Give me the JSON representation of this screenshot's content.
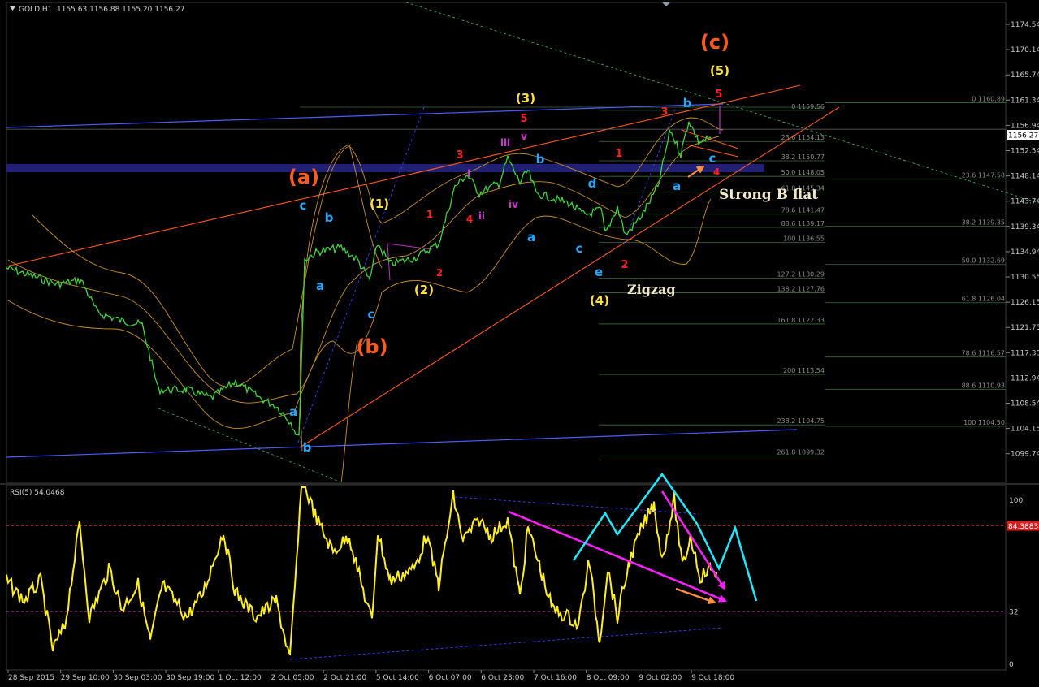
{
  "header": {
    "symbol_tf": "GOLD,H1",
    "ohlc": "1155.63 1156.88 1155.20 1156.27"
  },
  "price_axis": {
    "labels": [
      "1174.54",
      "1170.14",
      "1165.74",
      "1161.34",
      "1156.94",
      "1152.54",
      "1148.14",
      "1143.74",
      "1139.34",
      "1134.94",
      "1130.55",
      "1126.15",
      "1121.75",
      "1117.35",
      "1112.94",
      "1108.54",
      "1104.15",
      "1099.74"
    ],
    "current_price": "1156.27"
  },
  "rsi": {
    "title": "RSI(5) 54.0468",
    "levels": [
      "100",
      "32",
      "0"
    ],
    "upper_level_tag": "84.3883"
  },
  "time_axis": {
    "labels": [
      "28 Sep 2015",
      "29 Sep 10:00",
      "30 Sep 03:00",
      "30 Sep 19:00",
      "1 Oct 12:00",
      "2 Oct 05:00",
      "2 Oct 21:00",
      "5 Oct 14:00",
      "6 Oct 07:00",
      "6 Oct 23:00",
      "7 Oct 16:00",
      "8 Oct 09:00",
      "9 Oct 02:00",
      "9 Oct 18:00"
    ]
  },
  "fib_a": [
    {
      "label": "0 1159.56",
      "price": 1159.56
    },
    {
      "label": "23.6 1154.13",
      "price": 1154.13
    },
    {
      "label": "38.2 1150.77",
      "price": 1150.77
    },
    {
      "label": "50.0 1148.05",
      "price": 1148.05
    },
    {
      "label": "61.8 1145.34",
      "price": 1145.34
    },
    {
      "label": "78.6 1141.47",
      "price": 1141.47
    },
    {
      "label": "88.6 1139.17",
      "price": 1139.17
    },
    {
      "label": "100 1136.55",
      "price": 1136.55
    },
    {
      "label": "127.2 1130.29",
      "price": 1130.29
    },
    {
      "label": "138.2 1127.76",
      "price": 1127.76
    },
    {
      "label": "161.8 1122.33",
      "price": 1122.33
    },
    {
      "label": "200 1113.54",
      "price": 1113.54
    },
    {
      "label": "238.2 1104.75",
      "price": 1104.75
    },
    {
      "label": "261.8 1099.32",
      "price": 1099.32
    }
  ],
  "fib_b": [
    {
      "label": "0 1160.89",
      "price": 1160.89
    },
    {
      "label": "23.6 1147.58",
      "price": 1147.58
    },
    {
      "label": "38.2 1139.35",
      "price": 1139.35
    },
    {
      "label": "50.0 1132.69",
      "price": 1132.69
    },
    {
      "label": "61.8 1126.04",
      "price": 1126.04
    },
    {
      "label": "78.6 1116.57",
      "price": 1116.57
    },
    {
      "label": "88.6 1110.93",
      "price": 1110.93
    },
    {
      "label": "100 1104.50",
      "price": 1104.5
    }
  ],
  "wave_labels": [
    {
      "t": "(c)",
      "c": "#ff5a1e",
      "s": 24
    },
    {
      "t": "(5)",
      "c": "#ffe040",
      "s": 15
    },
    {
      "t": "5",
      "c": "#ff2020",
      "s": 13
    },
    {
      "t": "b",
      "c": "#2aa8ff",
      "s": 15
    },
    {
      "t": "3",
      "c": "#ff2020",
      "s": 13
    },
    {
      "t": "c",
      "c": "#2aa8ff",
      "s": 15
    },
    {
      "t": "4",
      "c": "#ff2020",
      "s": 12
    },
    {
      "t": "a",
      "c": "#2aa8ff",
      "s": 15
    },
    {
      "t": "(3)",
      "c": "#ffe040",
      "s": 15
    },
    {
      "t": "5",
      "c": "#ff2020",
      "s": 13
    },
    {
      "t": "v",
      "c": "#d030d0",
      "s": 12
    },
    {
      "t": "iii",
      "c": "#d030d0",
      "s": 12
    },
    {
      "t": "3",
      "c": "#ff2020",
      "s": 13
    },
    {
      "t": "i",
      "c": "#d030d0",
      "s": 12
    },
    {
      "t": "b",
      "c": "#2aa8ff",
      "s": 15
    },
    {
      "t": "iv",
      "c": "#d030d0",
      "s": 12
    },
    {
      "t": "ii",
      "c": "#d030d0",
      "s": 12
    },
    {
      "t": "4",
      "c": "#ff2020",
      "s": 12
    },
    {
      "t": "1",
      "c": "#ff2020",
      "s": 12
    },
    {
      "t": "a",
      "c": "#2aa8ff",
      "s": 15
    },
    {
      "t": "1",
      "c": "#ff2020",
      "s": 13
    },
    {
      "t": "d",
      "c": "#2aa8ff",
      "s": 15
    },
    {
      "t": "c",
      "c": "#2aa8ff",
      "s": 15
    },
    {
      "t": "e",
      "c": "#2aa8ff",
      "s": 15
    },
    {
      "t": "2",
      "c": "#ff2020",
      "s": 13
    },
    {
      "t": "(4)",
      "c": "#ffe040",
      "s": 15
    },
    {
      "t": "(a)",
      "c": "#ff5a1e",
      "s": 24
    },
    {
      "t": "c",
      "c": "#2aa8ff",
      "s": 15
    },
    {
      "t": "b",
      "c": "#2aa8ff",
      "s": 15
    },
    {
      "t": "(1)",
      "c": "#ffe040",
      "s": 15
    },
    {
      "t": "a",
      "c": "#2aa8ff",
      "s": 15
    },
    {
      "t": "c",
      "c": "#2aa8ff",
      "s": 15
    },
    {
      "t": "(b)",
      "c": "#ff5a1e",
      "s": 24
    },
    {
      "t": "(2)",
      "c": "#ffe040",
      "s": 15
    },
    {
      "t": "2",
      "c": "#ff2020",
      "s": 12
    },
    {
      "t": "a",
      "c": "#2aa8ff",
      "s": 15
    },
    {
      "t": "b",
      "c": "#2aa8ff",
      "s": 15
    }
  ],
  "annotations": {
    "flat": "Strong B flat",
    "zigzag": "Zigzag"
  },
  "chart_data": {
    "type": "line",
    "instrument": "GOLD",
    "timeframe": "H1",
    "ylim": [
      1097.5,
      1178.5
    ],
    "x": [
      "28 Sep 2015",
      "29 Sep 10:00",
      "30 Sep 03:00",
      "30 Sep 19:00",
      "1 Oct 12:00",
      "2 Oct 05:00",
      "2 Oct 21:00",
      "5 Oct 14:00",
      "6 Oct 07:00",
      "6 Oct 23:00",
      "7 Oct 16:00",
      "8 Oct 09:00",
      "9 Oct 02:00",
      "9 Oct 18:00"
    ],
    "series": [
      {
        "name": "GOLD,H1",
        "values": [
          1133,
          1127,
          1124,
          1114,
          1116,
          1106,
          1137,
          1136,
          1150,
          1153,
          1149,
          1140,
          1152,
          1156
        ]
      },
      {
        "name": "RSI(5)",
        "values": [
          40,
          38,
          45,
          35,
          50,
          10,
          65,
          50,
          70,
          62,
          50,
          30,
          68,
          54
        ]
      }
    ],
    "rsi_levels": [
      32,
      84.3883
    ]
  }
}
